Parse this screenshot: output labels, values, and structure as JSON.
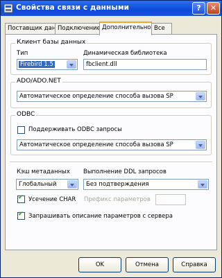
{
  "window": {
    "title": "Свойства связи с данными",
    "help_glyph": "?",
    "close_glyph": "✕"
  },
  "tabs": [
    {
      "label": "Поставщик данных",
      "active": false
    },
    {
      "label": "Подключение",
      "active": false
    },
    {
      "label": "Дополнительно",
      "active": true
    },
    {
      "label": "Все",
      "active": false
    }
  ],
  "client_db": {
    "title": "Клиент базы данных",
    "type_label": "Тип",
    "type_value": "Firebird 1.5",
    "lib_label": "Динамическая библиотека",
    "lib_value": "fbclient.dll"
  },
  "ado": {
    "title": "ADO/ADO.NET",
    "value": "Автоматическое определение способа вызова SP"
  },
  "odbc": {
    "title": "ODBC",
    "support_label": "Поддерживать ODBC запросы",
    "support_checked": false,
    "value": "Автоматическое определение способа вызова SP"
  },
  "meta": {
    "cache_label": "Кэш метаданных",
    "cache_value": "Глобальный",
    "ddl_label": "Выполнение DDL запросов",
    "ddl_value": "Без подтверждения",
    "char_label": "Усечение CHAR",
    "char_checked": true,
    "prefix_label": "Префикс параметров",
    "prefix_value": "",
    "request_label": "Запрашивать описание параметров с сервера",
    "request_checked": true
  },
  "buttons": {
    "ok": "OK",
    "cancel": "Отмена",
    "help": "Справка"
  }
}
